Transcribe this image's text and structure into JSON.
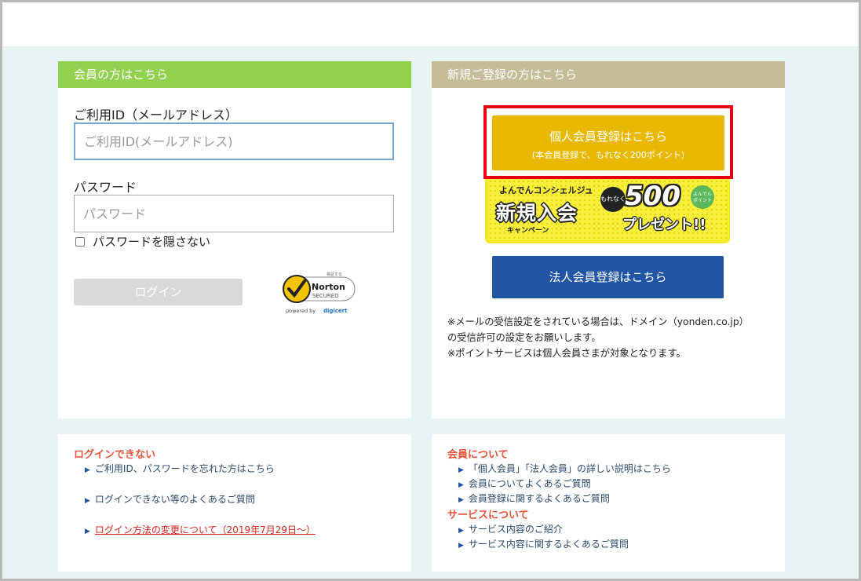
{
  "login_panel": {
    "header": "会員の方はこちら",
    "id_label": "ご利用ID（メールアドレス）",
    "id_placeholder": "ご利用ID(メールアドレス)",
    "password_label": "パスワード",
    "password_placeholder": "パスワード",
    "show_password_label": "パスワードを隠さない",
    "show_password_checked": false,
    "login_button": "ログイン",
    "norton_badge": {
      "verified_text": "検証する",
      "brand": "Norton",
      "secured": "SECURED",
      "powered_by": "powered by",
      "provider": "digicert"
    }
  },
  "register_panel": {
    "header": "新規ご登録の方はこちら",
    "individual_button": "個人会員登録はこちら",
    "individual_button_sub": "(本会員登録で、もれなく200ポイント)",
    "campaign": {
      "brand": "よんでんコンシェルジュ",
      "title": "新規入会",
      "subtitle": "キャンペーン",
      "badge": "もれなく",
      "amount": "500",
      "point_badge": "よんでん ポイント",
      "present": "プレゼント!!"
    },
    "corporate_button": "法人会員登録はこちら",
    "notes": [
      "※メールの受信設定をされている場合は、ドメイン（yonden.co.jp）",
      "の受信許可の設定をお願いします。",
      "※ポイントサービスは個人会員さまが対象となります。"
    ]
  },
  "help_left": {
    "heading": "ログインできない",
    "links": [
      "ご利用ID、パスワードを忘れた方はこちら",
      "ログインできない等のよくあるご質問",
      "ログイン方法の変更について（2019年7月29日～）"
    ]
  },
  "help_right": {
    "heading_members": "会員について",
    "member_links": [
      "「個人会員」「法人会員」の詳しい説明はこちら",
      "会員についてよくあるご質問",
      "会員登録に関するよくあるご質問"
    ],
    "heading_services": "サービスについて",
    "service_links": [
      "サービス内容のご紹介",
      "サービス内容に関するよくあるご質問"
    ]
  },
  "colors": {
    "login_header": "#92d050",
    "register_header": "#c4bd97",
    "individual_button": "#e8b900",
    "highlight_border": "#e60012",
    "corporate_button": "#2156a5",
    "help_heading": "#e8543a",
    "background": "#e8f3f3"
  }
}
